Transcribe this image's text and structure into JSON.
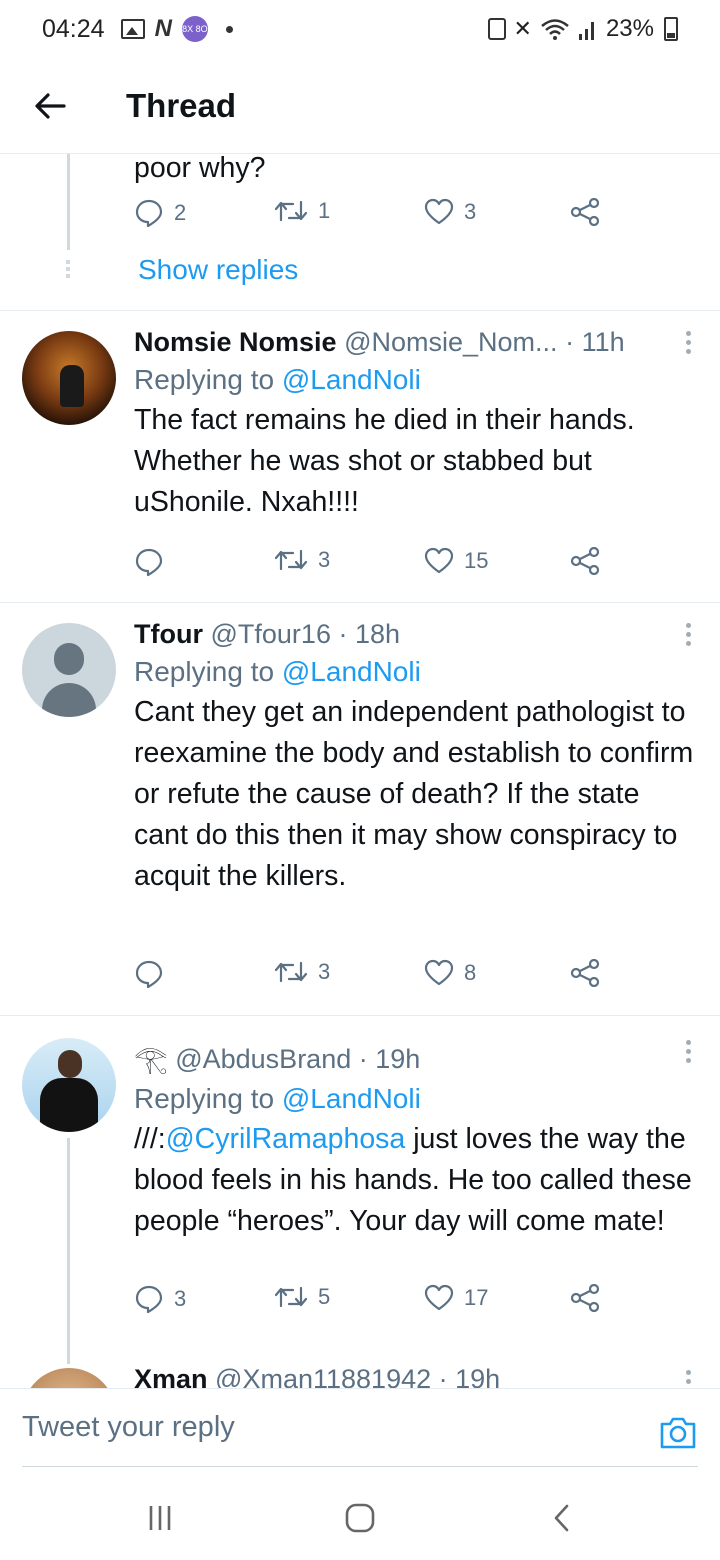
{
  "status_bar": {
    "time": "04:24",
    "app_badge": "8X 8O",
    "battery": "23%"
  },
  "header": {
    "title": "Thread"
  },
  "top_tweet": {
    "text": "poor why?",
    "reply_count": "2",
    "retweet_count": "1",
    "like_count": "3",
    "show_replies": "Show replies"
  },
  "tweets": [
    {
      "name": "Nomsie Nomsie",
      "handle": "@Nomsie_Nom...",
      "time": "· 11h",
      "replying_prefix": "Replying to",
      "replying_to": "@LandNoli",
      "text": "The fact remains he died in their hands. Whether he was shot or stabbed but uShonile. Nxah!!!!",
      "reply_count": "",
      "retweet_count": "3",
      "like_count": "15"
    },
    {
      "name": "Tfour",
      "handle": "@Tfour16",
      "time": "· 18h",
      "replying_prefix": "Replying to",
      "replying_to": "@LandNoli",
      "text": "Cant they get an independent pathologist to reexamine the body and establish to confirm or refute the cause of death? If the state cant do this then it may show conspiracy to acquit the killers.",
      "reply_count": "",
      "retweet_count": "3",
      "like_count": "8"
    },
    {
      "name": "",
      "handle": "@AbdusBrand",
      "time": "· 19h",
      "replying_prefix": "Replying to",
      "replying_to": "@LandNoli",
      "text_prefix": "///:",
      "text_mention": "@CyrilRamaphosa",
      "text_rest": " just loves the way the blood feels in his hands. He too called these people “heroes”. Your day will come mate!",
      "reply_count": "3",
      "retweet_count": "5",
      "like_count": "17"
    },
    {
      "name": "Xman",
      "handle": "@Xman11881942",
      "time": "· 19h"
    }
  ],
  "reply_bar": {
    "placeholder": "Tweet your reply"
  },
  "icons": {
    "back": "arrow-left-icon",
    "reply": "speech-bubble-icon",
    "retweet": "retweet-icon",
    "like": "heart-icon",
    "share": "share-icon",
    "camera": "camera-icon",
    "more": "kebab-icon"
  },
  "colors": {
    "accent": "#1d9bf0",
    "secondary_text": "#5b7083",
    "divider": "#e6ecf0"
  }
}
